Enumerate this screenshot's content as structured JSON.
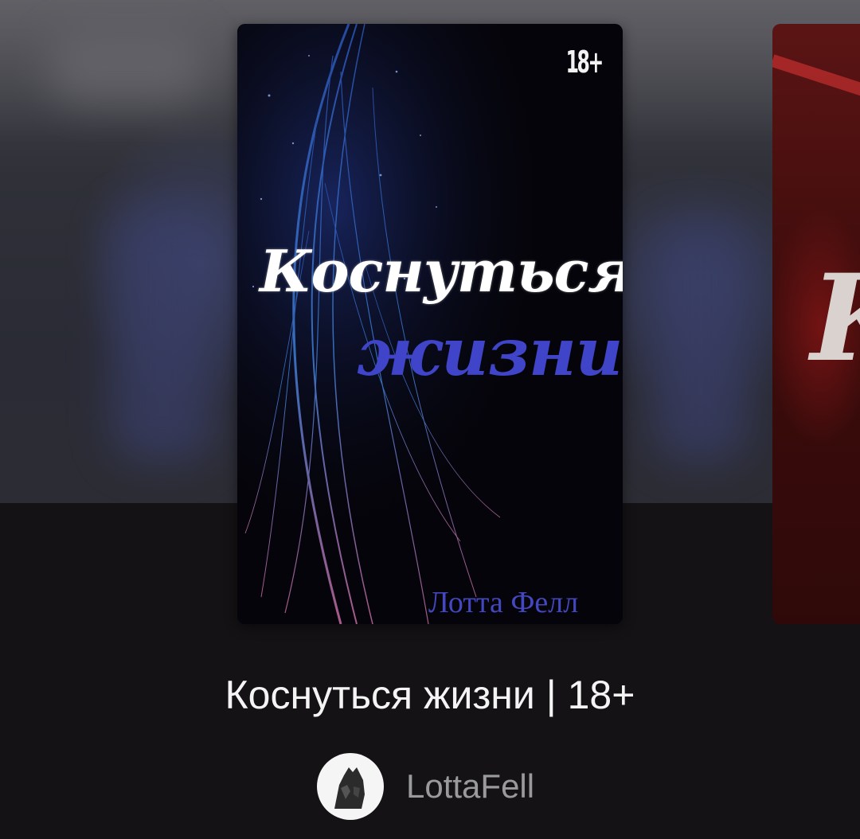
{
  "book": {
    "title": "Коснуться жизни | 18+",
    "cover_age_badge": "18+",
    "cover_title_line1": "Коснуться",
    "cover_title_line2": "жизни",
    "cover_author": "Лотта Фелл",
    "author_username": "LottaFell"
  },
  "colors": {
    "background": "#141214",
    "cover_title_accent": "#3f44c8",
    "author_text": "#9a9a9c"
  },
  "icons": {
    "avatar": "wolf-avatar-icon"
  }
}
